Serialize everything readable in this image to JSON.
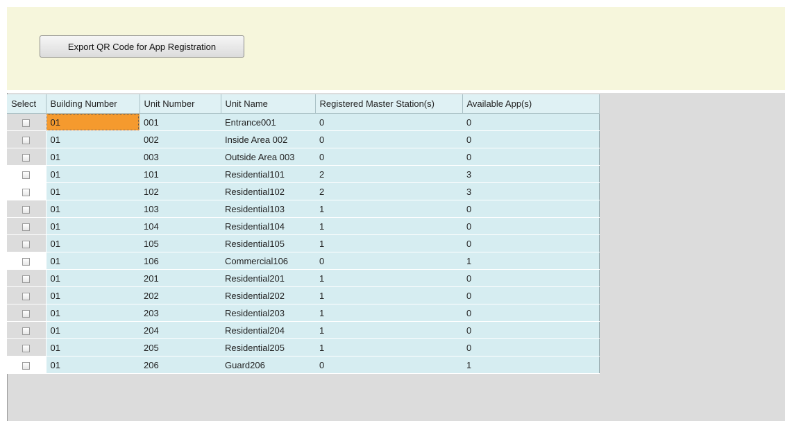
{
  "toolbar": {
    "export_label": "Export QR Code for App Registration"
  },
  "table": {
    "columns": [
      "Select",
      "Building Number",
      "Unit Number",
      "Unit Name",
      "Registered Master Station(s)",
      "Available App(s)"
    ],
    "rows": [
      {
        "building": "01",
        "unit": "001",
        "name": "Entrance001",
        "registered": "0",
        "apps": "0"
      },
      {
        "building": "01",
        "unit": "002",
        "name": "Inside Area 002",
        "registered": "0",
        "apps": "0"
      },
      {
        "building": "01",
        "unit": "003",
        "name": "Outside Area 003",
        "registered": "0",
        "apps": "0"
      },
      {
        "building": "01",
        "unit": "101",
        "name": "Residential101",
        "registered": "2",
        "apps": "3"
      },
      {
        "building": "01",
        "unit": "102",
        "name": "Residential102",
        "registered": "2",
        "apps": "3"
      },
      {
        "building": "01",
        "unit": "103",
        "name": "Residential103",
        "registered": "1",
        "apps": "0"
      },
      {
        "building": "01",
        "unit": "104",
        "name": "Residential104",
        "registered": "1",
        "apps": "0"
      },
      {
        "building": "01",
        "unit": "105",
        "name": "Residential105",
        "registered": "1",
        "apps": "0"
      },
      {
        "building": "01",
        "unit": "106",
        "name": "Commercial106",
        "registered": "0",
        "apps": "1"
      },
      {
        "building": "01",
        "unit": "201",
        "name": "Residential201",
        "registered": "1",
        "apps": "0"
      },
      {
        "building": "01",
        "unit": "202",
        "name": "Residential202",
        "registered": "1",
        "apps": "0"
      },
      {
        "building": "01",
        "unit": "203",
        "name": "Residential203",
        "registered": "1",
        "apps": "0"
      },
      {
        "building": "01",
        "unit": "204",
        "name": "Residential204",
        "registered": "1",
        "apps": "0"
      },
      {
        "building": "01",
        "unit": "205",
        "name": "Residential205",
        "registered": "1",
        "apps": "0"
      },
      {
        "building": "01",
        "unit": "206",
        "name": "Guard206",
        "registered": "0",
        "apps": "1"
      }
    ]
  },
  "colors": {
    "top_panel": "#f6f6dc",
    "table_bg": "#d6edf1",
    "focus_cell": "#f59a2e",
    "grid_bg": "#dcdcdc"
  }
}
